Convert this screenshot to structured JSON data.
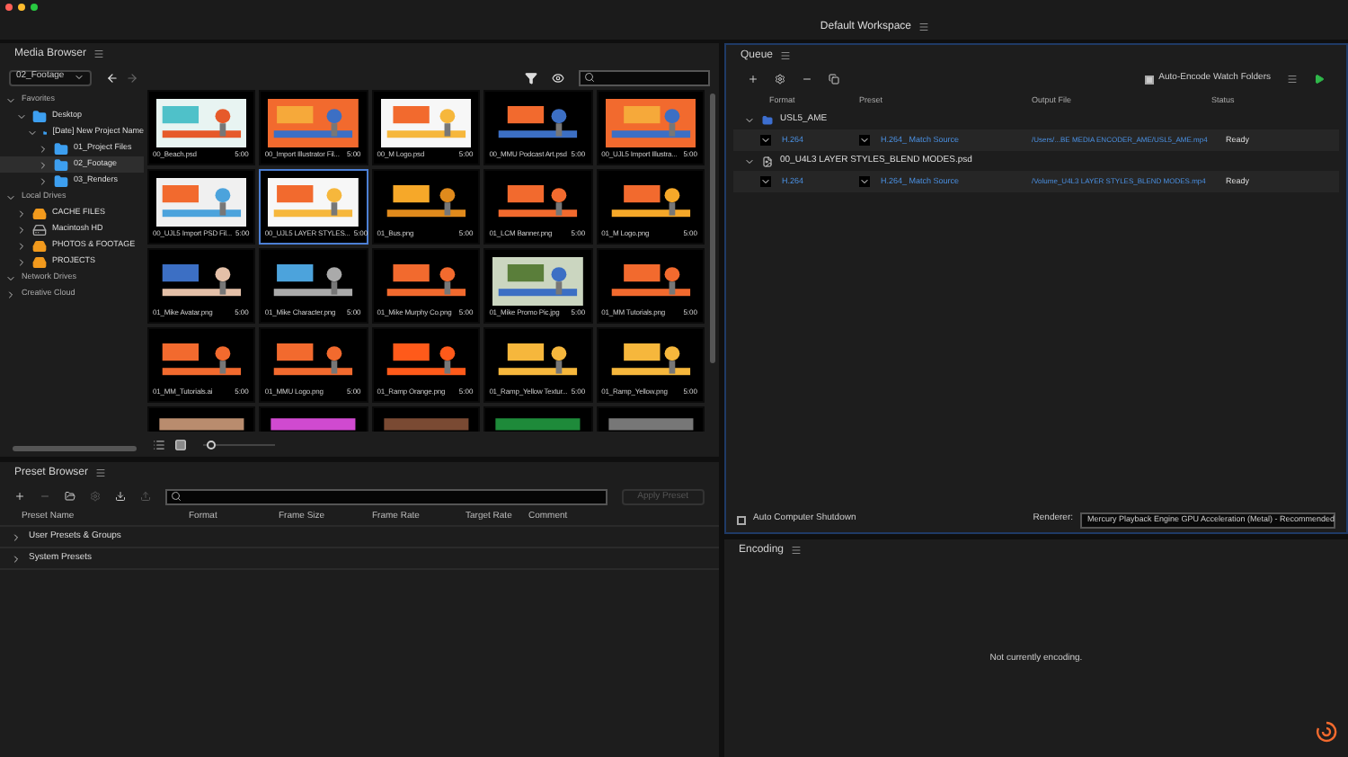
{
  "workspace": {
    "label": "Default Workspace"
  },
  "media_browser": {
    "title": "Media Browser",
    "location": "02_Footage",
    "tree": [
      {
        "label": "Favorites",
        "kind": "section",
        "expanded": true,
        "children": [
          {
            "label": "Desktop",
            "kind": "folder",
            "expanded": true,
            "selected": false,
            "children": [
              {
                "label": "[Date] New Project Name",
                "kind": "folder",
                "expanded": true,
                "selected": false,
                "children": [
                  {
                    "label": "01_Project Files",
                    "kind": "folder",
                    "expanded": false,
                    "selected": false
                  },
                  {
                    "label": "02_Footage",
                    "kind": "folder",
                    "expanded": false,
                    "selected": true
                  },
                  {
                    "label": "03_Renders",
                    "kind": "folder",
                    "expanded": false,
                    "selected": false
                  }
                ]
              }
            ]
          }
        ]
      },
      {
        "label": "Local Drives",
        "kind": "section",
        "expanded": true,
        "children": [
          {
            "label": "CACHE FILES",
            "kind": "drive",
            "expanded": false,
            "selected": false
          },
          {
            "label": "Macintosh HD",
            "kind": "disk",
            "expanded": false,
            "selected": false
          },
          {
            "label": "PHOTOS & FOOTAGE",
            "kind": "drive",
            "expanded": false,
            "selected": false
          },
          {
            "label": "PROJECTS",
            "kind": "drive",
            "expanded": false,
            "selected": false
          }
        ]
      },
      {
        "label": "Network Drives",
        "kind": "section",
        "expanded": true
      },
      {
        "label": "Creative Cloud",
        "kind": "section",
        "expanded": false
      }
    ],
    "thumbnails": [
      {
        "name": "00_Beach.psd",
        "duration": "5:00",
        "selected": false
      },
      {
        "name": "00_Import Illustrator Fil...",
        "duration": "5:00",
        "selected": false
      },
      {
        "name": "00_M Logo.psd",
        "duration": "5:00",
        "selected": false
      },
      {
        "name": "00_MMU Podcast Art.psd",
        "duration": "5:00",
        "selected": false
      },
      {
        "name": "00_UJL5 Import Illustra...",
        "duration": "5:00",
        "selected": false
      },
      {
        "name": "00_UJL5 Import PSD Fil...",
        "duration": "5:00",
        "selected": false
      },
      {
        "name": "00_UJL5 LAYER STYLES...",
        "duration": "5:00",
        "selected": true
      },
      {
        "name": "01_Bus.png",
        "duration": "5:00",
        "selected": false
      },
      {
        "name": "01_LCM Banner.png",
        "duration": "5:00",
        "selected": false
      },
      {
        "name": "01_M Logo.png",
        "duration": "5:00",
        "selected": false
      },
      {
        "name": "01_Mike Avatar.png",
        "duration": "5:00",
        "selected": false
      },
      {
        "name": "01_Mike Character.png",
        "duration": "5:00",
        "selected": false
      },
      {
        "name": "01_Mike Murphy Co.png",
        "duration": "5:00",
        "selected": false
      },
      {
        "name": "01_Mike Promo Pic.jpg",
        "duration": "5:00",
        "selected": false
      },
      {
        "name": "01_MM Tutorials.png",
        "duration": "5:00",
        "selected": false
      },
      {
        "name": "01_MM_Tutorials.ai",
        "duration": "5:00",
        "selected": false
      },
      {
        "name": "01_MMU Logo.png",
        "duration": "5:00",
        "selected": false
      },
      {
        "name": "01_Ramp Orange.png",
        "duration": "5:00",
        "selected": false
      },
      {
        "name": "01_Ramp_Yellow Textur...",
        "duration": "5:00",
        "selected": false
      },
      {
        "name": "01_Ramp_Yellow.png",
        "duration": "5:00",
        "selected": false
      },
      {
        "kind": "picture"
      },
      {
        "kind": "picture"
      },
      {
        "kind": "picture"
      },
      {
        "kind": "picture"
      },
      {
        "kind": "picture"
      }
    ],
    "zoom": {
      "level": 0.05
    }
  },
  "preset_browser": {
    "title": "Preset Browser",
    "apply_button": "Apply Preset",
    "columns": [
      "Preset Name",
      "Format",
      "Frame Size",
      "Frame Rate",
      "Target Rate",
      "Comment"
    ],
    "groups": [
      {
        "label": "User Presets & Groups",
        "expanded": false
      },
      {
        "label": "System Presets",
        "expanded": false
      }
    ]
  },
  "queue": {
    "title": "Queue",
    "auto_encode": {
      "label": "Auto-Encode Watch Folders",
      "checked": true
    },
    "columns": [
      "Format",
      "Preset",
      "Output File",
      "Status"
    ],
    "items": [
      {
        "name": "USL5_AME",
        "kind": "watch-folder",
        "expanded": true,
        "format": "H.264",
        "preset": "H.264_ Match Source",
        "output": "/Users/...BE MEDIA ENCODER_AME/USL5_AME.mp4",
        "status": "Ready"
      },
      {
        "name": "00_U4L3 LAYER STYLES_BLEND MODES.psd",
        "kind": "file",
        "expanded": true,
        "format": "H.264",
        "preset": "H.264_ Match Source",
        "output": "/Volume_U4L3 LAYER STYLES_BLEND MODES.mp4",
        "status": "Ready"
      }
    ],
    "shutdown": {
      "label": "Auto Computer Shutdown",
      "checked": false
    },
    "renderer": {
      "label": "Renderer:",
      "value": "Mercury Playback Engine GPU Acceleration (Metal) - Recommended"
    }
  },
  "encoding": {
    "title": "Encoding",
    "message": "Not currently encoding."
  }
}
